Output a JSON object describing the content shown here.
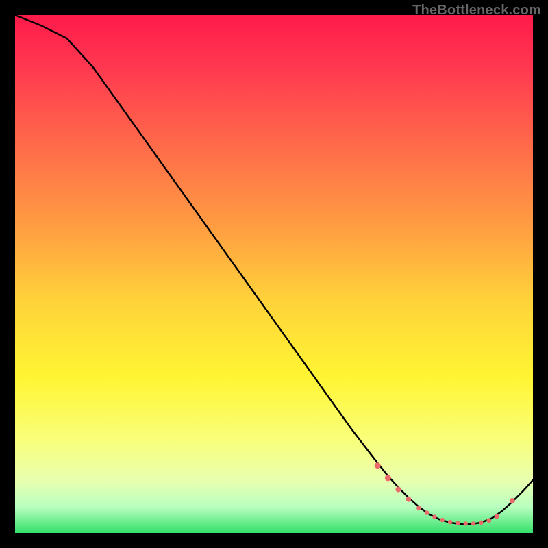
{
  "watermark": "TheBottleneck.com",
  "chart_data": {
    "type": "line",
    "title": "",
    "xlabel": "",
    "ylabel": "",
    "xlim": [
      0,
      100
    ],
    "ylim": [
      0,
      100
    ],
    "background_gradient": {
      "stops": [
        {
          "offset": 0.0,
          "color": "#ff1a4a"
        },
        {
          "offset": 0.1,
          "color": "#ff3850"
        },
        {
          "offset": 0.25,
          "color": "#ff6a4a"
        },
        {
          "offset": 0.4,
          "color": "#ff9a42"
        },
        {
          "offset": 0.55,
          "color": "#ffd23a"
        },
        {
          "offset": 0.7,
          "color": "#fff533"
        },
        {
          "offset": 0.82,
          "color": "#f9ff7a"
        },
        {
          "offset": 0.9,
          "color": "#e8ffb0"
        },
        {
          "offset": 0.95,
          "color": "#b8ffbf"
        },
        {
          "offset": 1.0,
          "color": "#34e06a"
        }
      ]
    },
    "x": [
      0,
      5,
      10,
      15,
      20,
      25,
      30,
      35,
      40,
      45,
      50,
      55,
      60,
      65,
      70,
      72,
      74,
      76,
      78,
      80,
      82,
      84,
      86,
      88,
      90,
      92,
      94,
      96,
      98,
      100
    ],
    "curve_y": [
      100,
      98,
      95.5,
      90,
      83,
      76,
      69,
      62,
      55,
      48,
      41,
      34,
      27,
      20,
      13.5,
      11,
      8.8,
      6.8,
      5.0,
      3.6,
      2.6,
      2.0,
      1.7,
      1.7,
      2.0,
      2.8,
      4.2,
      6.0,
      8.0,
      10.2
    ],
    "markers": {
      "x": [
        70,
        72,
        74,
        76,
        78,
        79.5,
        81,
        82.5,
        84,
        85.5,
        87,
        88.5,
        90,
        91.5,
        93,
        96
      ],
      "y": [
        13.0,
        10.6,
        8.4,
        6.5,
        4.8,
        3.9,
        3.1,
        2.5,
        2.1,
        1.9,
        1.8,
        1.8,
        2.0,
        2.4,
        3.2,
        6.2
      ],
      "size": [
        4.5,
        4.5,
        4.0,
        3.8,
        3.5,
        3.3,
        3.2,
        3.2,
        3.2,
        3.2,
        3.2,
        3.2,
        3.2,
        3.3,
        3.5,
        4.0
      ],
      "color": "#ea6a6a"
    }
  }
}
